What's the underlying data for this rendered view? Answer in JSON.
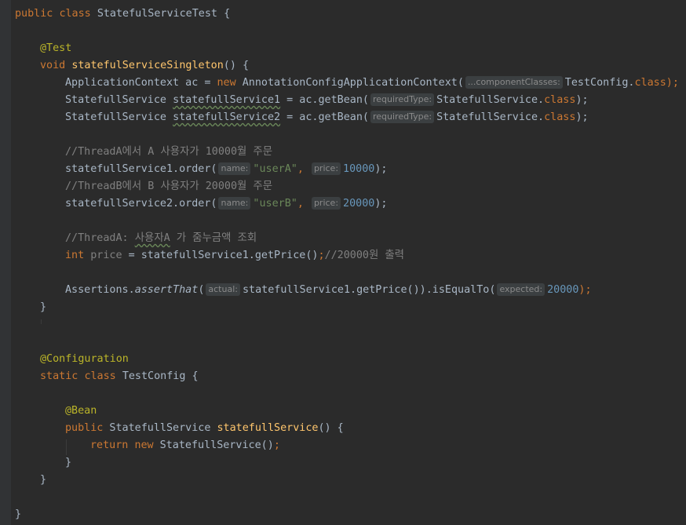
{
  "editor": {
    "colors": {
      "background": "#2b2b2b",
      "keyword": "#cc7832",
      "method_decl": "#ffc66d",
      "annotation": "#bbb529",
      "string": "#6a8759",
      "number": "#6897bb",
      "comment": "#808080",
      "text": "#a9b7c6"
    },
    "class_decl": {
      "modifier": "public",
      "keyword": "class",
      "name": "StatefulServiceTest",
      "brace": "{"
    },
    "test_annotation": "@Test",
    "test_method": {
      "return_type": "void",
      "name": "statefulServiceSingleton",
      "suffix": "() {"
    },
    "line_ac": {
      "type": "ApplicationContext ac = ",
      "new_kw": "new",
      "ctor": " AnnotationConfigApplicationContext(",
      "hint": "...componentClasses:",
      "arg": "TestConfig.",
      "class_kw": "class",
      "end": ");"
    },
    "line_svc1": {
      "type": "StatefullService ",
      "var": "statefullService1",
      "mid": " = ac.getBean(",
      "hint": "requiredType:",
      "arg": "StatefullService.",
      "class_kw": "class",
      "end": ");"
    },
    "line_svc2": {
      "type": "StatefullService ",
      "var": "statefullService2",
      "mid": " = ac.getBean(",
      "hint": "requiredType:",
      "arg": "StatefullService.",
      "class_kw": "class",
      "end": ");"
    },
    "comment_a": "//ThreadA에서 A 사용자가 10000월 주문",
    "order_a": {
      "call": "statefullService1.order(",
      "name_hint": "name:",
      "name_val": "\"userA\"",
      "comma": ",",
      "price_hint": "price:",
      "price_val": "10000",
      "end": ");"
    },
    "comment_b": "//ThreadB에서 B 사용자가 20000월 주문",
    "order_b": {
      "call": "statefullService2.order(",
      "name_hint": "name:",
      "name_val": "\"userB\"",
      "comma": ",",
      "price_hint": "price:",
      "price_val": "20000",
      "end": ");"
    },
    "comment_price_pre": "//ThreadA: ",
    "comment_price_user": "사용자A",
    "comment_price_post": " 가 줌누금액 조회",
    "price_line": {
      "int_kw": "int",
      "var": " price",
      "rest": " = statefullService1.getPrice()",
      "semicolon": ";",
      "comment": "//20000원 출력"
    },
    "assert_line": {
      "prefix": "Assertions.",
      "method": "assertThat",
      "open": "(",
      "actual_hint": "actual:",
      "actual_arg": "statefullService1.getPrice()).isEqualTo(",
      "expected_hint": "expected:",
      "expected_val": "20000",
      "end": ");"
    },
    "close_method": "}",
    "config_annotation": "@Configuration",
    "config_class": {
      "static_kw": "static",
      "class_kw": "class",
      "name": "TestConfig",
      "brace": "{"
    },
    "bean_annotation": "@Bean",
    "bean_method": {
      "public_kw": "public",
      "type": " StatefullService ",
      "name": "statefullService",
      "suffix": "() {"
    },
    "return_line": {
      "return_kw": "return",
      "new_kw": "new",
      "rest": " StatefullService()",
      "semicolon": ";"
    },
    "close_bean": "}",
    "close_config": "}",
    "close_class": "}"
  }
}
